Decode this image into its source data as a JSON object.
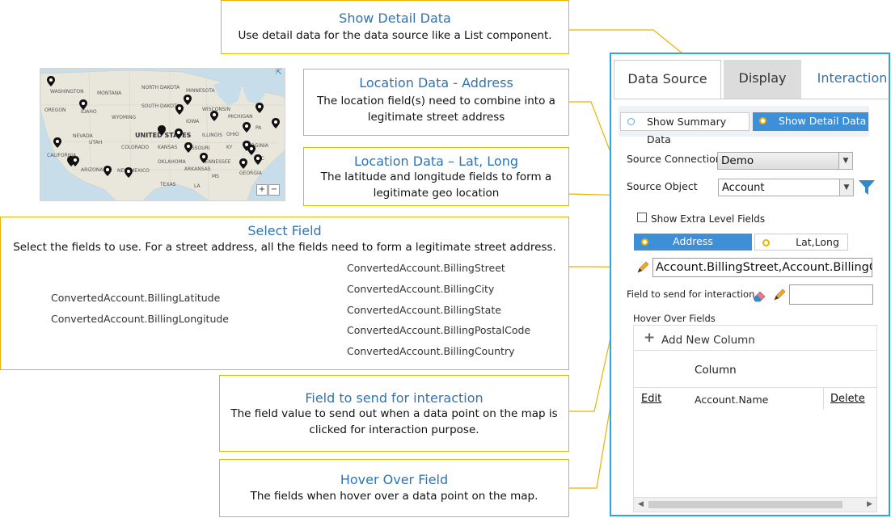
{
  "callouts": {
    "detail": {
      "title": "Show Detail Data",
      "body": "Use detail data for the data source like a List component."
    },
    "address": {
      "title": "Location Data - Address",
      "body": "The location field(s) need to combine into a legitimate street address"
    },
    "latlong": {
      "title": "Location Data – Lat, Long",
      "body": "The latitude and longitude fields to form a legitimate geo location"
    },
    "select": {
      "title": "Select Field",
      "body": "Select the fields to use. For a street address, all the fields need to form a legitimate street address."
    },
    "interaction": {
      "title": "Field to send for interaction",
      "body": "The field value to send out when a data point on the map is clicked for interaction purpose."
    },
    "hover": {
      "title": "Hover Over Field",
      "body": "The fields when hover over a data point on the map."
    }
  },
  "select_fields": {
    "latlong": [
      "ConvertedAccount.BillingLatitude",
      "ConvertedAccount.BillingLongitude"
    ],
    "address": [
      "ConvertedAccount.BillingStreet",
      "ConvertedAccount.BillingCity",
      "ConvertedAccount.BillingState",
      "ConvertedAccount.BillingPostalCode",
      "ConvertedAccount.BillingCountry"
    ]
  },
  "map": {
    "labels": [
      "WASHINGTON",
      "MONTANA",
      "NORTH DAKOTA",
      "MINNESOTA",
      "OREGON",
      "IDAHO",
      "SOUTH DAKOTA",
      "WISCONSIN",
      "WYOMING",
      "IOWA",
      "MICHIGAN",
      "NEVADA",
      "UNITED STATES",
      "ILLINOIS",
      "OHIO",
      "PA",
      "UTAH",
      "COLORADO",
      "KANSAS",
      "MISSOURI",
      "KY",
      "VIRGINIA",
      "CALIFORNIA",
      "NC",
      "ARIZONA",
      "OKLAHOMA",
      "TENNESSEE",
      "NEW MEXICO",
      "ARKANSAS",
      "TEXAS",
      "LA",
      "GEORGIA",
      "MS"
    ],
    "zoom_in": "+",
    "zoom_out": "−",
    "expand_icon": "expand-icon"
  },
  "panel": {
    "tabs": [
      "Data Source",
      "Display",
      "Interaction"
    ],
    "summary_label": "Show Summary Data",
    "detail_label": "Show Detail Data",
    "source_connection_label": "Source Connection",
    "source_connection_value": "Demo",
    "source_object_label": "Source Object",
    "source_object_value": "Account",
    "extra_fields_label": "Show Extra Level Fields",
    "address_label": "Address",
    "latlong_label": "Lat,Long",
    "field_value": "Account.BillingStreet,Account.BillingCity",
    "send_label": "Field to send for interaction",
    "send_value": "",
    "hover_label": "Hover Over Fields",
    "add_column": "Add New Column",
    "column_header": "Column",
    "edit": "Edit",
    "row_field": "Account.Name",
    "delete": "Delete"
  },
  "colors": {
    "callout_border": "#e8b400",
    "title_blue": "#2e74b5",
    "panel_border": "#29a7e1",
    "active_blue": "#3d8fd8"
  }
}
